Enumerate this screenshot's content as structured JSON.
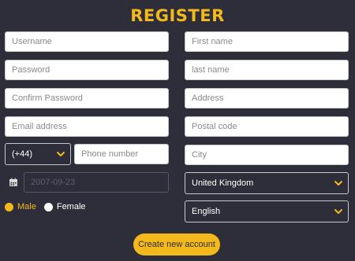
{
  "title": "REGISTER",
  "colors": {
    "background": "#2d2e39",
    "accent": "#f3b81c",
    "input_bg": "#ffffff"
  },
  "left": {
    "username_placeholder": "Username",
    "password_placeholder": "Password",
    "confirm_password_placeholder": "Confirm Password",
    "email_placeholder": "Email address",
    "phone_code_value": "(+44)",
    "phone_placeholder": "Phone number",
    "date_placeholder": "2007-09-23"
  },
  "right": {
    "first_name_placeholder": "First name",
    "last_name_placeholder": "last name",
    "address_placeholder": "Address",
    "postal_code_placeholder": "Postal code",
    "city_placeholder": "City",
    "country_value": "United Kingdom",
    "language_value": "English"
  },
  "gender": {
    "options": [
      {
        "label": "Male",
        "selected": true
      },
      {
        "label": "Female",
        "selected": false
      }
    ]
  },
  "submit_label": "Create new account",
  "icons": {
    "date": "calendar-icon",
    "dropdown": "chevron-down-icon"
  }
}
